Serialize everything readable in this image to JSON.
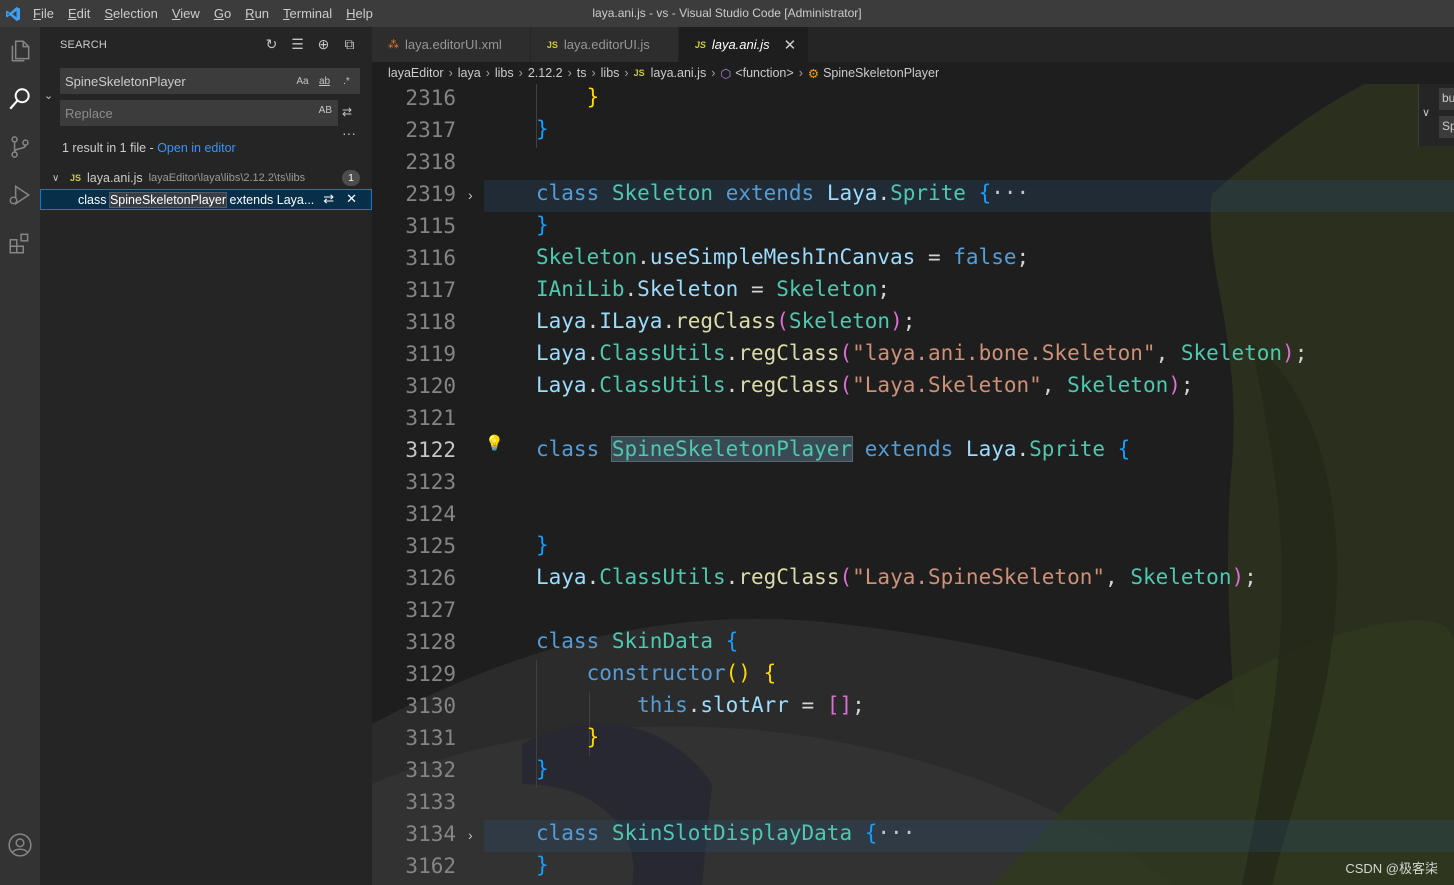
{
  "window": {
    "title": "laya.ani.js - vs - Visual Studio Code [Administrator]",
    "menu": [
      {
        "mn": "F",
        "rest": "ile"
      },
      {
        "mn": "E",
        "rest": "dit"
      },
      {
        "mn": "S",
        "rest": "election"
      },
      {
        "mn": "V",
        "rest": "iew"
      },
      {
        "mn": "G",
        "rest": "o"
      },
      {
        "mn": "R",
        "rest": "un"
      },
      {
        "mn": "T",
        "rest": "erminal"
      },
      {
        "mn": "H",
        "rest": "elp"
      }
    ]
  },
  "sidebar": {
    "title": "SEARCH",
    "search_value": "SpineSkeletonPlayer",
    "replace_placeholder": "Replace",
    "opt_case": "Aa",
    "opt_word": "ab",
    "opt_regex": ".*",
    "opt_preserve": "AB",
    "result_info_prefix": "1 result in 1 file - ",
    "result_info_link": "Open in editor",
    "file": {
      "badge": "JS",
      "name": "laya.ani.js",
      "path": "layaEditor\\laya\\libs\\2.12.2\\ts\\libs",
      "count": "1"
    },
    "match": {
      "before": "class ",
      "highlight": "SpineSkeletonPlayer",
      "after": " extends Laya..."
    }
  },
  "tabs": [
    {
      "icon": "xml",
      "label": "laya.editorUI.xml",
      "active": false
    },
    {
      "icon": "JS",
      "label": "laya.editorUI.js",
      "active": false
    },
    {
      "icon": "JS",
      "label": "laya.ani.js",
      "active": true
    }
  ],
  "breadcrumbs": [
    "layaEditor",
    "laya",
    "libs",
    "2.12.2",
    "ts",
    "libs",
    "laya.ani.js",
    "<function>",
    "SpineSkeletonPlayer"
  ],
  "breadcrumb_js_badge": "JS",
  "line_numbers": [
    "2316",
    "2317",
    "2318",
    "2319",
    "3115",
    "3116",
    "3117",
    "3118",
    "3119",
    "3120",
    "3121",
    "3122",
    "3123",
    "3124",
    "3125",
    "3126",
    "3127",
    "3128",
    "3129",
    "3130",
    "3131",
    "3132",
    "3133",
    "3134",
    "3162"
  ],
  "current_line": "3122",
  "widget": {
    "a": "bu",
    "b": "Sp"
  },
  "watermark": "CSDN @极客柒",
  "colors": {
    "keyword": "#569cd6",
    "class": "#4ec9b0",
    "function": "#dcdcaa",
    "string": "#ce9178",
    "accent": "#007fd4"
  }
}
